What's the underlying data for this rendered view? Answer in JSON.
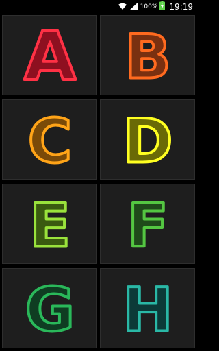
{
  "status_bar": {
    "battery_percent": "100%",
    "time": "19:19"
  },
  "letters": [
    {
      "char": "A",
      "fill": "#8e1020",
      "stroke": "#ff3145"
    },
    {
      "char": "B",
      "fill": "#7a3010",
      "stroke": "#ff6a1f"
    },
    {
      "char": "C",
      "fill": "#7a4a08",
      "stroke": "#ffa418"
    },
    {
      "char": "D",
      "fill": "#6a6a06",
      "stroke": "#ffff21"
    },
    {
      "char": "E",
      "fill": "#3a5a10",
      "stroke": "#9ae23c"
    },
    {
      "char": "F",
      "fill": "#1f4a1a",
      "stroke": "#54c642"
    },
    {
      "char": "G",
      "fill": "#0f3d22",
      "stroke": "#2ab85a"
    },
    {
      "char": "H",
      "fill": "#0c3a38",
      "stroke": "#2ab8a6"
    }
  ]
}
